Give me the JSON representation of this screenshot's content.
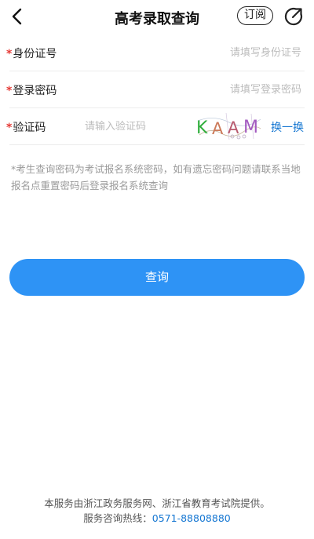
{
  "nav": {
    "title": "高考录取查询",
    "subscribe_label": "订阅"
  },
  "form": {
    "id_card": {
      "required_mark": "*",
      "label": "身份证号",
      "placeholder": "请填写身份证号"
    },
    "password": {
      "required_mark": "*",
      "label": "登录密码",
      "placeholder": "请填写登录密码"
    },
    "captcha": {
      "required_mark": "*",
      "label": "验证码",
      "placeholder": "请输入验证码",
      "image_letters": [
        "K",
        "A",
        "A",
        "M"
      ],
      "image_letter_colors": [
        "#2fae3c",
        "#cc7a5a",
        "#b85a6e",
        "#a35ac0"
      ],
      "refresh_label": "换一换"
    }
  },
  "note": "*考生查询密码为考试报名系统密码，如有遗忘密码问题请联系当地报名点重置密码后登录报名系统查询",
  "query_button": "查询",
  "footer": {
    "line1": "本服务由浙江政务服务网、浙江省教育考试院提供。",
    "line2_prefix": "服务咨询热线：",
    "hotline": "0571-88808880"
  },
  "colors": {
    "primary": "#2e93f5",
    "link": "#1677d2",
    "required": "#e53935"
  },
  "icons": {
    "back": "back-icon",
    "share": "share-icon"
  }
}
